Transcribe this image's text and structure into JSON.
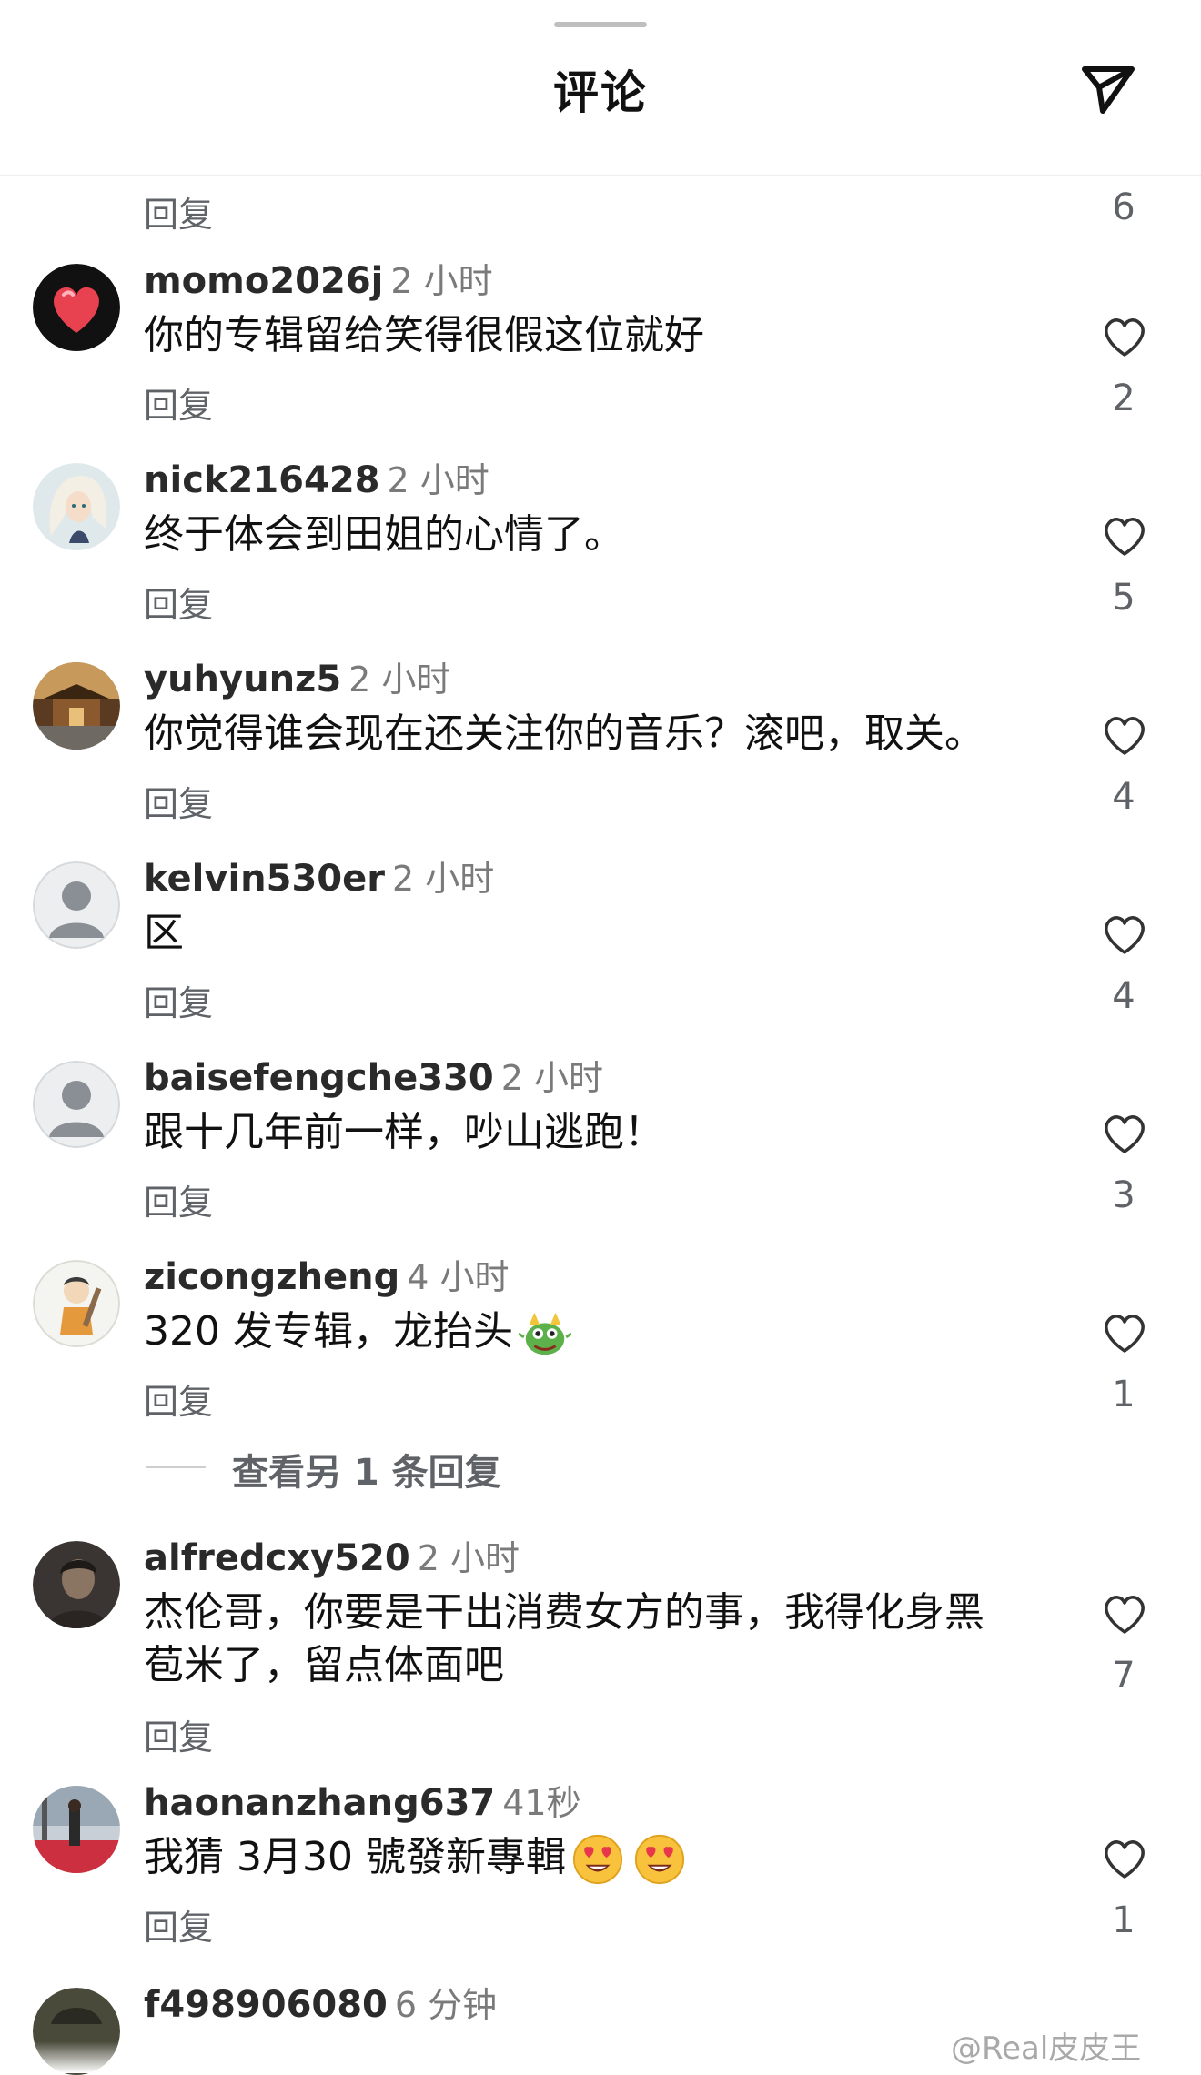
{
  "header": {
    "title": "评论",
    "share_icon": "send-icon"
  },
  "top_partial": {
    "reply_label": "回复",
    "like_count": "6"
  },
  "comments": [
    {
      "username": "momo2026j",
      "time": "2 小时",
      "text": "你的专辑留给笑得很假这位就好",
      "reply_label": "回复",
      "like_count": "2",
      "avatar": "red-heart-avatar"
    },
    {
      "username": "nick216428",
      "time": "2 小时",
      "text": "终于体会到田姐的心情了。",
      "reply_label": "回复",
      "like_count": "5",
      "avatar": "anime-girl-avatar"
    },
    {
      "username": "yuhyunz5",
      "time": "2 小时",
      "text": "你觉得谁会现在还关注你的音乐？滚吧，取关。",
      "reply_label": "回复",
      "like_count": "4",
      "avatar": "temple-photo-avatar"
    },
    {
      "username": "kelvin530er",
      "time": "2 小时",
      "text": "区",
      "reply_label": "回复",
      "like_count": "4",
      "avatar": "default-person-avatar"
    },
    {
      "username": "baisefengche330",
      "time": "2 小时",
      "text": "跟十几年前一样，吵山逃跑！",
      "reply_label": "回复",
      "like_count": "3",
      "avatar": "default-person-avatar"
    },
    {
      "username": "zicongzheng",
      "time": "4 小时",
      "text": "320 发专辑，龙抬头",
      "emoji": "dragon-emoji",
      "reply_label": "回复",
      "like_count": "1",
      "avatar": "cartoon-caveman-avatar"
    },
    {
      "username": "alfredcxy520",
      "time": "2 小时",
      "text": "杰伦哥，你要是干出消费女方的事，我得化身黑苞米了，留点体面吧",
      "reply_label": "回复",
      "like_count": "7",
      "avatar": "dark-portrait-avatar"
    },
    {
      "username": "haonanzhang637",
      "time": "41秒",
      "text": "我猜 3月30 號發新專輯",
      "emoji": "heart-eyes-emoji",
      "reply_label": "回复",
      "like_count": "1",
      "avatar": "street-photo-avatar"
    },
    {
      "username": "f498906080",
      "time": "6 分钟",
      "avatar": "partial-avatar"
    }
  ],
  "view_more_replies": "查看另 1 条回复",
  "watermark": "@Real皮皮王",
  "colors": {
    "text": "#111111",
    "secondary": "#5f6368",
    "divider": "#eeeeee",
    "heart_outline": "#333333"
  }
}
